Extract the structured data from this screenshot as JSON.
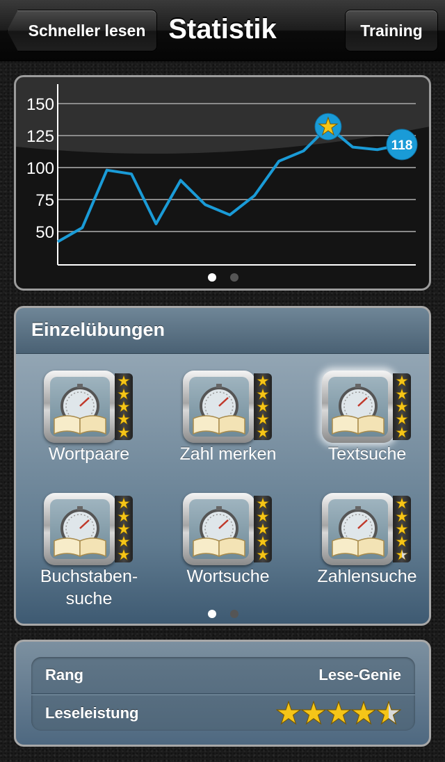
{
  "navbar": {
    "back_label": "Schneller lesen",
    "title": "Statistik",
    "training_label": "Training"
  },
  "chart_data": {
    "type": "line",
    "y_ticks": [
      150,
      125,
      100,
      75,
      50
    ],
    "ylim": [
      30,
      165
    ],
    "series": [
      {
        "values": [
          42,
          53,
          98,
          95,
          56,
          90,
          71,
          63,
          78,
          105,
          113,
          132,
          116,
          114,
          118
        ]
      }
    ],
    "best_marker_index": 11,
    "last_value_label": "118",
    "line_color": "#1a9bd7",
    "grid": true
  },
  "chart_pager": {
    "pages": 2,
    "active": 0
  },
  "exercises": {
    "title": "Einzelübungen",
    "items": [
      {
        "label": "Wortpaare",
        "stars": 5,
        "selected": false
      },
      {
        "label": "Zahl merken",
        "stars": 5,
        "selected": false
      },
      {
        "label": "Textsuche",
        "stars": 5,
        "selected": true
      },
      {
        "label": "Buchstaben-\nsuche",
        "stars": 5,
        "selected": false
      },
      {
        "label": "Wortsuche",
        "stars": 5,
        "selected": false
      },
      {
        "label": "Zahlensuche",
        "stars": 4.5,
        "selected": false
      }
    ],
    "pager": {
      "pages": 2,
      "active": 0
    }
  },
  "rank": {
    "rang_label": "Rang",
    "rang_value": "Lese-Genie",
    "leistung_label": "Leseleistung",
    "leistung_stars": 4.5,
    "leistung_max": 5
  },
  "colors": {
    "star_gold": "#f5c518",
    "star_silver": "#d9d9d9",
    "accent_blue": "#1a9bd7"
  }
}
